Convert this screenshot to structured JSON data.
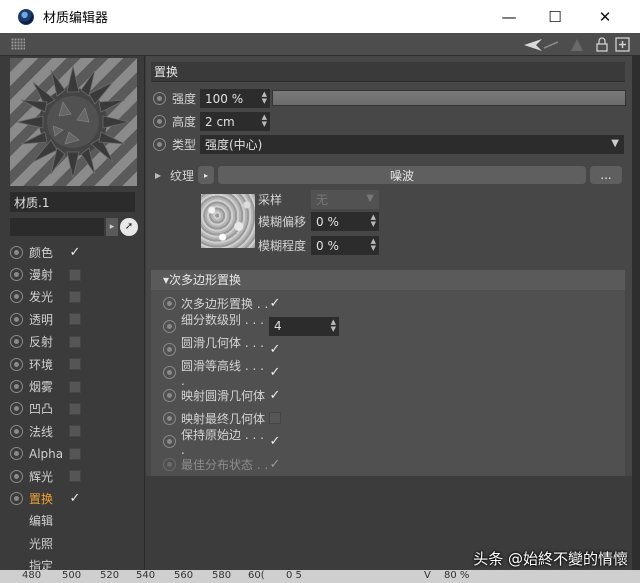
{
  "window": {
    "title": "材质编辑器",
    "minimize": "—",
    "maximize": "☐",
    "close": "✕"
  },
  "material": {
    "name": "材质.1"
  },
  "channels": [
    {
      "label": "颜色",
      "checked": true
    },
    {
      "label": "漫射",
      "checked": false
    },
    {
      "label": "发光",
      "checked": false
    },
    {
      "label": "透明",
      "checked": false
    },
    {
      "label": "反射",
      "checked": false
    },
    {
      "label": "环境",
      "checked": false
    },
    {
      "label": "烟雾",
      "checked": false
    },
    {
      "label": "凹凸",
      "checked": false
    },
    {
      "label": "法线",
      "checked": false
    },
    {
      "label": "Alpha",
      "checked": false
    },
    {
      "label": "辉光",
      "checked": false
    },
    {
      "label": "置换",
      "checked": true,
      "active": true
    }
  ],
  "sub_items": [
    "编辑",
    "光照",
    "指定"
  ],
  "displacement": {
    "header": "置换",
    "strength_label": "强度",
    "strength_value": "100 %",
    "height_label": "高度",
    "height_value": "2 cm",
    "type_label": "类型",
    "type_value": "强度(中心)",
    "texture_label": "纹理",
    "texture_button": "噪波",
    "more_button": "...",
    "sampling_label": "采样",
    "sampling_value": "无",
    "blur_offset_label": "模糊偏移",
    "blur_offset_value": "0 %",
    "blur_scale_label": "模糊程度",
    "blur_scale_value": "0 %"
  },
  "subpoly": {
    "header": "▾次多边形置换",
    "options": [
      {
        "label": "次多边形置换 . .",
        "checked": true,
        "disabled": false
      },
      {
        "label": "细分数级别 . . . .",
        "value": "4",
        "disabled": false
      },
      {
        "label": "圆滑几何体 . . . .",
        "checked": true,
        "disabled": false
      },
      {
        "label": "圆滑等高线 . . . .",
        "checked": true,
        "disabled": false
      },
      {
        "label": "映射圆滑几何体",
        "checked": true,
        "disabled": false
      },
      {
        "label": "映射最终几何体",
        "checked": false,
        "disabled": false
      },
      {
        "label": "保持原始边 . . . .",
        "checked": true,
        "disabled": false
      },
      {
        "label": "最佳分布状态 . .",
        "checked": true,
        "disabled": true
      }
    ]
  },
  "ruler": [
    "480",
    "500",
    "520",
    "540",
    "560",
    "580",
    "60(",
    "0 5",
    "V",
    "80 %"
  ],
  "watermark": "头条 @始終不變的情懷"
}
